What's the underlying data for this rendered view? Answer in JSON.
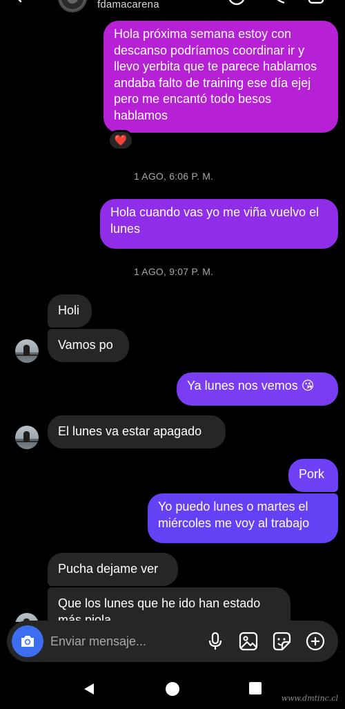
{
  "header": {
    "contact_name": "fdamacarena"
  },
  "messages": {
    "out1": "Hola próxima semana estoy con descanso podríamos coordinar ir y llevo yerbita que te parece hablamos andaba falto de training ese día ejej pero me encantó todo besos hablamos",
    "reaction": "❤️",
    "ts1": "1 AGO, 6:06 P. M.",
    "out2": "Hola cuando vas yo me viña vuelvo el lunes",
    "ts2": "1 AGO, 9:07 P. M.",
    "in1": "Holi",
    "in2": "Vamos po",
    "out3": "Ya lunes nos vemos 😘",
    "in3": "El lunes va estar apagado",
    "out4": "Pork",
    "out5": "Yo puedo lunes o martes el miércoles me voy al trabajo",
    "in4": "Pucha dejame ver",
    "in5": "Que los lunes que he ido han estado más piola"
  },
  "composer": {
    "placeholder": "Enviar mensaje..."
  },
  "watermark": "www.dmtinc.cl",
  "icons": {
    "camera": "camera-icon",
    "mic": "microphone-icon",
    "gallery": "image-icon",
    "sticker": "sticker-icon",
    "add": "plus-circle-icon",
    "back": "triangle-back",
    "home": "circle-home",
    "recents": "square-recents"
  },
  "colors": {
    "accent_blue": "#3d6ef2",
    "bubble_incoming": "#262626",
    "bubble_magenta": "#b621d6",
    "bubble_violet": "#6541f5"
  }
}
